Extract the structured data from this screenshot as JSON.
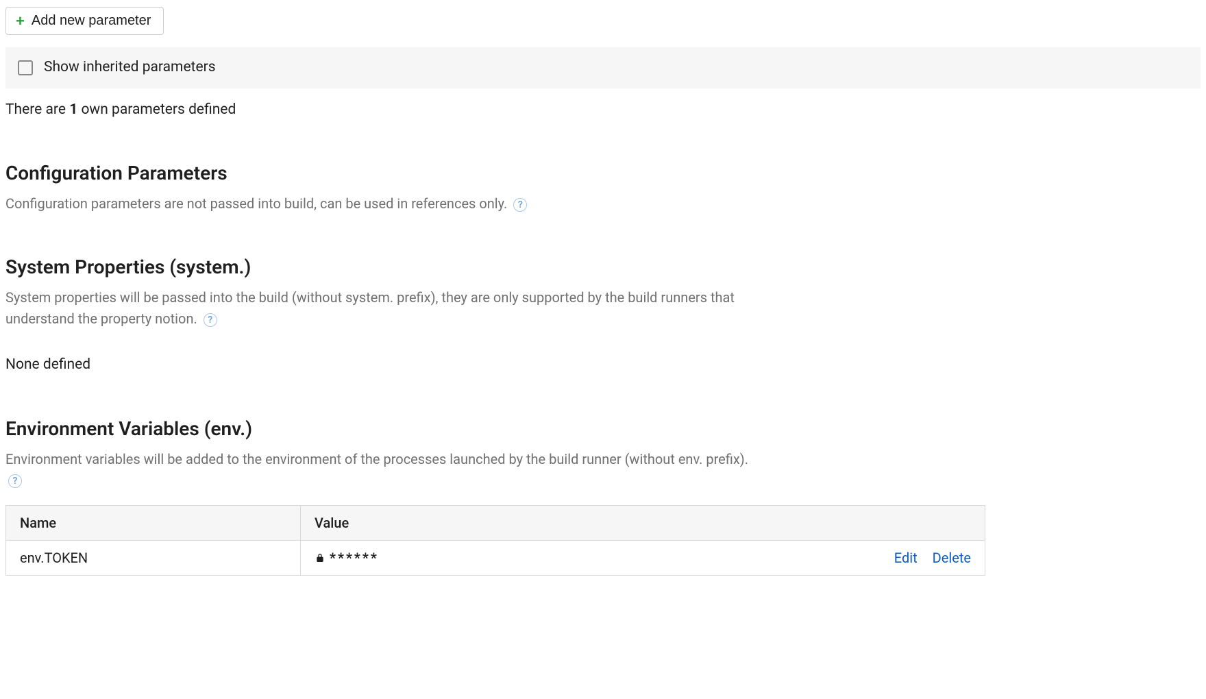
{
  "toolbar": {
    "add_label": "Add new parameter"
  },
  "inherited": {
    "label": "Show inherited parameters"
  },
  "summary": {
    "prefix": "There are ",
    "count": "1",
    "suffix": " own parameters defined"
  },
  "sections": {
    "config": {
      "title": "Configuration Parameters",
      "desc": "Configuration parameters are not passed into build, can be used in references only."
    },
    "system": {
      "title": "System Properties (system.)",
      "desc": "System properties will be passed into the build (without system. prefix), they are only supported by the build runners that understand the property notion.",
      "none": "None defined"
    },
    "env": {
      "title": "Environment Variables (env.)",
      "desc": "Environment variables will be added to the environment of the processes launched by the build runner (without env. prefix).",
      "table": {
        "headers": {
          "name": "Name",
          "value": "Value"
        },
        "rows": [
          {
            "name": "env.TOKEN",
            "value": "******",
            "locked": true
          }
        ]
      },
      "actions": {
        "edit": "Edit",
        "delete": "Delete"
      }
    }
  }
}
